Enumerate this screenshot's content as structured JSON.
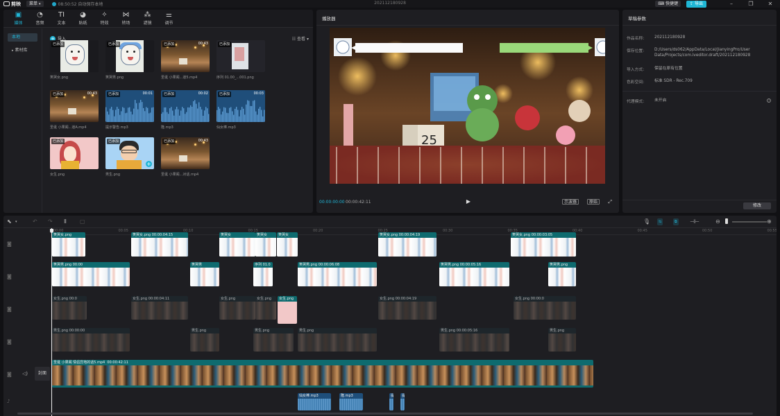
{
  "app": {
    "name": "剪映",
    "menu_label": "菜单",
    "save_status": "08:50:52 自动保存本地",
    "doc_title": "202112180928"
  },
  "topbar": {
    "shortcut_label": "快捷键",
    "export_label": "导出"
  },
  "toolbar_tabs": [
    {
      "label": "媒体",
      "icon": "media-icon",
      "glyph": "▣"
    },
    {
      "label": "音频",
      "icon": "audio-icon",
      "glyph": "◔"
    },
    {
      "label": "文本",
      "icon": "text-icon",
      "glyph": "TI"
    },
    {
      "label": "贴纸",
      "icon": "sticker-icon",
      "glyph": "◕"
    },
    {
      "label": "特效",
      "icon": "effects-icon",
      "glyph": "✧"
    },
    {
      "label": "转场",
      "icon": "transition-icon",
      "glyph": "⋈"
    },
    {
      "label": "滤镜",
      "icon": "filter-icon",
      "glyph": "⁂"
    },
    {
      "label": "调节",
      "icon": "adjust-icon",
      "glyph": "⚌"
    }
  ],
  "media_sidebar": {
    "local": "本地",
    "library": "素材库"
  },
  "media": {
    "import_label": "导入",
    "sort_label": "查看",
    "added_badge": "已添加",
    "items": [
      {
        "name": "笑哭女.png",
        "kind": "sticker",
        "duration": ""
      },
      {
        "name": "笑哭男.png",
        "kind": "sticker",
        "duration": ""
      },
      {
        "name": "圣诞 小果阁...道5.mp4",
        "kind": "video",
        "duration": "00:43"
      },
      {
        "name": "序列 01.00_...001.png",
        "kind": "grey",
        "duration": ""
      },
      {
        "name": "圣诞 小果阁...道A.mp4",
        "kind": "video",
        "duration": "00:43"
      },
      {
        "name": "提示警告.mp3",
        "kind": "audio",
        "duration": "00:01"
      },
      {
        "name": "隆.mp3",
        "kind": "audio",
        "duration": "00:02"
      },
      {
        "name": "仙女棒.mp3",
        "kind": "audio",
        "duration": "00:03"
      },
      {
        "name": "女生.png",
        "kind": "girl",
        "duration": ""
      },
      {
        "name": "男生.png",
        "kind": "boy",
        "duration": ""
      },
      {
        "name": "圣诞 小果阁...对话.mp4",
        "kind": "video",
        "duration": "00:43"
      }
    ]
  },
  "player": {
    "title": "播放器",
    "current_time": "00:00:00:00",
    "total_time": "00:00:42:11",
    "button_scope": "示波器",
    "button_ratio": "原始"
  },
  "draft": {
    "title": "草稿参数",
    "rows": [
      {
        "key": "作品名称:",
        "value": "202112180928"
      },
      {
        "key": "保存位置:",
        "value": "D:/Users/ds062/AppData/Local/JianyingPro/User Data/Projects/com.lveditor.draft/202112180928"
      },
      {
        "key": "导入方式:",
        "value": "保留在原有位置"
      },
      {
        "key": "色彩空间:",
        "value": "标准 SDR - Rec.709"
      },
      {
        "key": "代理模式:",
        "value": "未开启"
      }
    ],
    "modify_label": "修改"
  },
  "timeline": {
    "ruler_labels": [
      "00:00",
      "00:05",
      "00:10",
      "00:15",
      "00:20",
      "00:25",
      "00:30",
      "00:35",
      "00:40",
      "00:45",
      "00:50",
      "00:55"
    ],
    "cover_label": "封面",
    "main_clip": {
      "name": "圣诞 小果阁 情侣异地的话5.mp4",
      "duration": "00:00:42:11"
    },
    "tracks": [
      {
        "style": "sticker",
        "clips": [
          {
            "label": "笑哭女.png"
          },
          {
            "label": "笑哭女.png  00:00:04:15"
          },
          {
            "label": "笑哭女"
          },
          {
            "label": "笑哭女"
          },
          {
            "label": "笑哭女"
          },
          {
            "label": "笑哭女.png  00:00:04:19"
          },
          {
            "label": "笑哭女.png  00:00:03:05"
          }
        ]
      },
      {
        "style": "sticker",
        "clips": [
          {
            "label": "笑哭男.png  00:00"
          },
          {
            "label": "笑哭男"
          },
          {
            "label": "序列 01.0"
          },
          {
            "label": "笑哭男.png  00:00:06:08"
          },
          {
            "label": "笑哭男.png  00:00:05:16"
          },
          {
            "label": "笑哭男.png"
          }
        ]
      },
      {
        "style": "dim",
        "clips": [
          {
            "label": "女生.png  00:0"
          },
          {
            "label": "女生.png  00:00:04:11"
          },
          {
            "label": "女生.png"
          },
          {
            "label": "女生.png"
          },
          {
            "label": "女生.png  00:00:04:19"
          },
          {
            "label": "女生.png  00:00:0"
          }
        ]
      },
      {
        "style": "dim",
        "clips": [
          {
            "label": "男生.png  00:00:00"
          },
          {
            "label": "男生.png"
          },
          {
            "label": "男生.png"
          },
          {
            "label": "男生.png"
          },
          {
            "label": "男生.png  00:00:05:16"
          },
          {
            "label": "男生.png"
          }
        ]
      }
    ],
    "overlay_girl_label": "女生.png",
    "audio_clips": [
      {
        "label": "仙女棒.mp3"
      },
      {
        "label": "隆.mp3"
      },
      {
        "label": "提"
      },
      {
        "label": "提"
      }
    ]
  },
  "colors": {
    "accent": "#21b5d6",
    "panel": "#1e1e22",
    "track_teal": "#0e6b6f",
    "audio_blue": "#1e4e7a"
  }
}
